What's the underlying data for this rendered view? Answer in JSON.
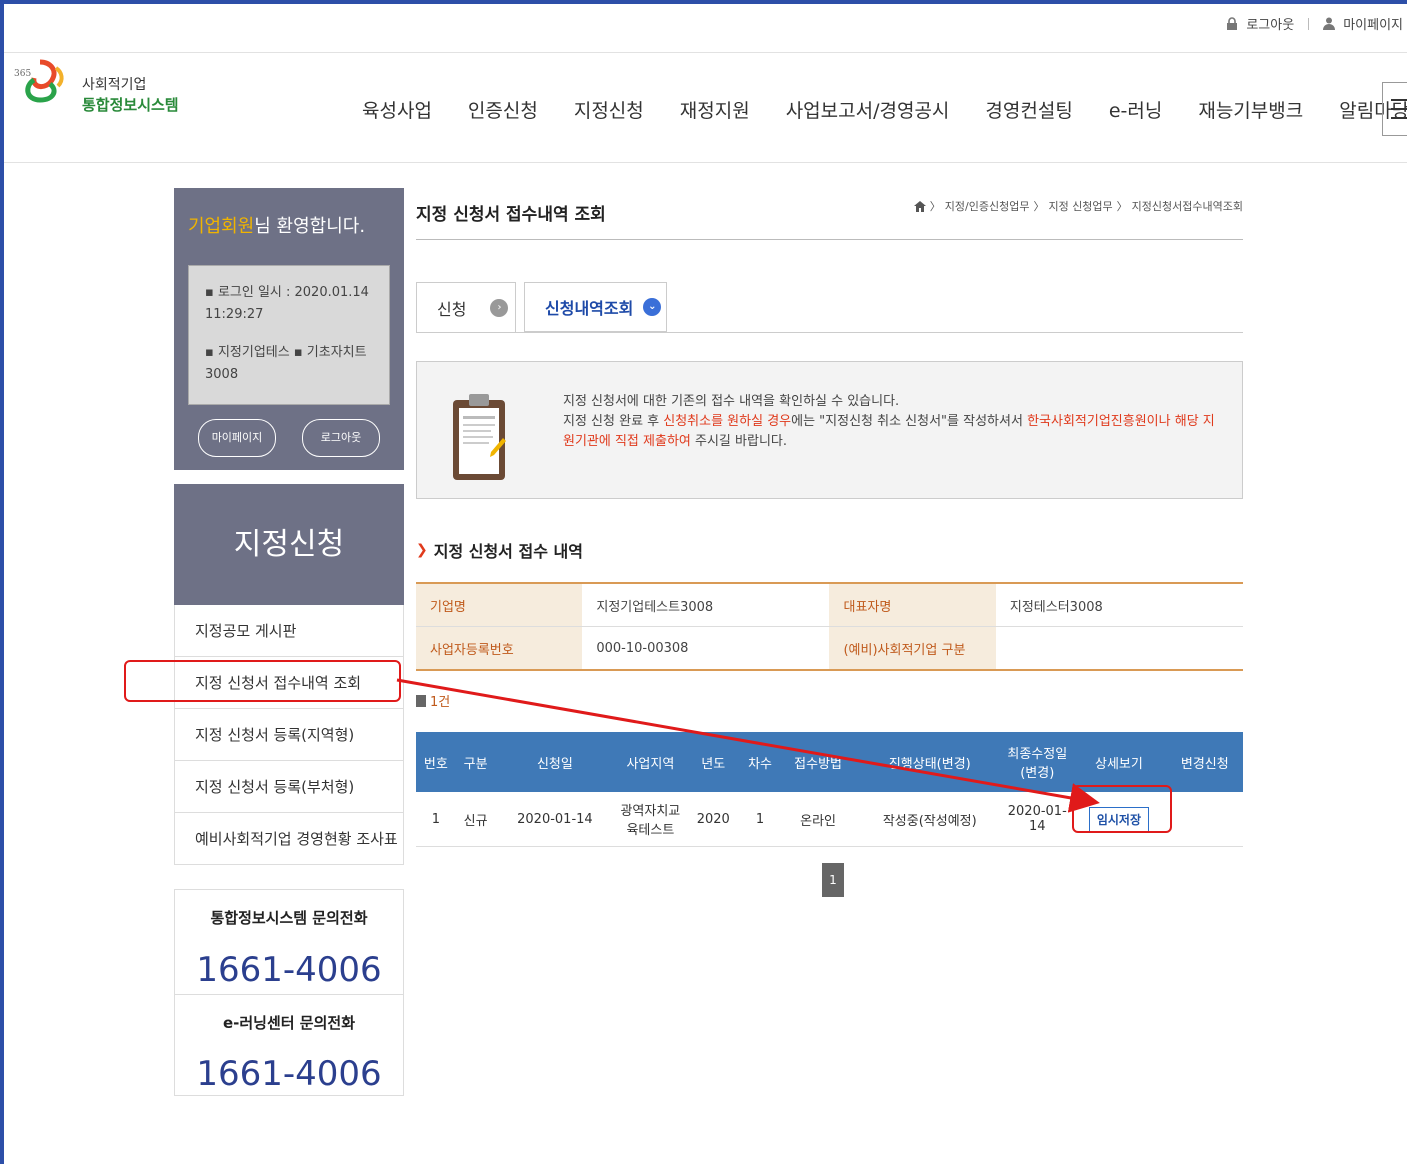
{
  "util": {
    "logout": "로그아웃",
    "mypage": "마이페이지"
  },
  "logo": {
    "line1": "사회적기업",
    "line2": "통합정보시스템"
  },
  "gnb": [
    "육성사업",
    "인증신청",
    "지정신청",
    "재정지원",
    "사업보고서/경영공시",
    "경영컨설팅",
    "e-러닝",
    "재능기부뱅크",
    "알림마당"
  ],
  "welcome": {
    "highlight": "기업회원",
    "rest": "님 환영합니다."
  },
  "login_info": {
    "line1": "▪ 로그인 일시 : 2020.01.14 11:29:27",
    "line2": "▪ 지정기업테스   ▪ 기초자치트3008"
  },
  "buttons": {
    "mypage": "마이페이지",
    "logout": "로그아웃"
  },
  "lnb": {
    "title": "지정신청",
    "items": [
      "지정공모 게시판",
      "지정 신청서 접수내역 조회",
      "지정 신청서 등록(지역형)",
      "지정 신청서 등록(부처형)",
      "예비사회적기업 경영현황 조사표"
    ]
  },
  "contact": {
    "label1": "통합정보시스템 문의전화",
    "number1": "1661-4006",
    "label2": "e-러닝센터 문의전화",
    "number2": "1661-4006"
  },
  "page": {
    "title": "지정 신청서 접수내역 조회",
    "breadcrumb": [
      "지정/인증신청업무",
      "지정 신청업무",
      "지정신청서접수내역조회"
    ]
  },
  "tabs": {
    "apply": "신청",
    "history": "신청내역조회"
  },
  "notice": {
    "line1": "지정 신청서에 대한 기존의 접수 내역을 확인하실 수 있습니다.",
    "line2_pre": "지정 신청 완료 후 ",
    "line2_red1": "신청취소를 원하실 경우",
    "line2_mid": "에는 \"지정신청 취소 신청서\"를 작성하셔서 ",
    "line2_red2": "한국사회적기업진흥원이나 해당 지원기관에 직접 제출하여",
    "line2_post": " 주시길 바랍니다."
  },
  "section_title": "지정 신청서 접수 내역",
  "company": {
    "name_label": "기업명",
    "name_value": "지정기업테스트3008",
    "rep_label": "대표자명",
    "rep_value": "지정테스터3008",
    "reg_label": "사업자등록번호",
    "reg_value": "000-10-00308",
    "type_label": "(예비)사회적기업 구분",
    "type_value": ""
  },
  "count": "1건",
  "list": {
    "headers": [
      "번호",
      "구분",
      "신청일",
      "사업지역",
      "년도",
      "차수",
      "접수방법",
      "진행상태(변경)",
      "최종수정일(변경)",
      "상세보기",
      "변경신청"
    ],
    "rows": [
      {
        "no": "1",
        "type": "신규",
        "date": "2020-01-14",
        "region": "광역자치교육테스트",
        "year": "2020",
        "round": "1",
        "method": "온라인",
        "status": "작성중(작성예정)",
        "modified": "2020-01-14",
        "detail": "임시저장",
        "change": ""
      }
    ]
  },
  "pager": "1",
  "colors": {
    "accent": "#e01a1a",
    "header_blue": "#3f79b7",
    "lnb_bg": "#6e7186",
    "orange": "#d99a55"
  }
}
